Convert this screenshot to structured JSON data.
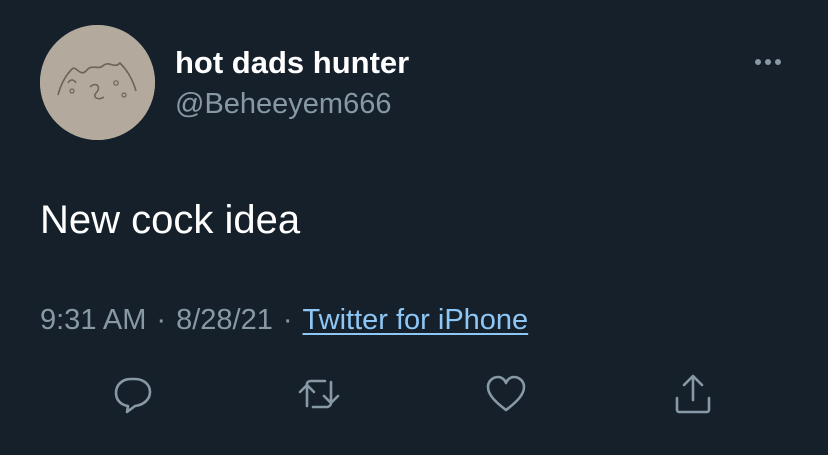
{
  "tweet": {
    "display_name": "hot dads hunter",
    "handle": "@Beheeyem666",
    "text": "New cock idea",
    "time": "9:31 AM",
    "date": "8/28/21",
    "separator": "·",
    "source": "Twitter for iPhone"
  },
  "icons": {
    "more": "more-horizontal-icon",
    "reply": "reply-bubble-icon",
    "retweet": "retweet-icon",
    "like": "heart-icon",
    "share": "share-upload-icon"
  },
  "colors": {
    "background": "#15202b",
    "text": "#ffffff",
    "secondary": "#8899a6",
    "link": "#8ec7f5"
  }
}
